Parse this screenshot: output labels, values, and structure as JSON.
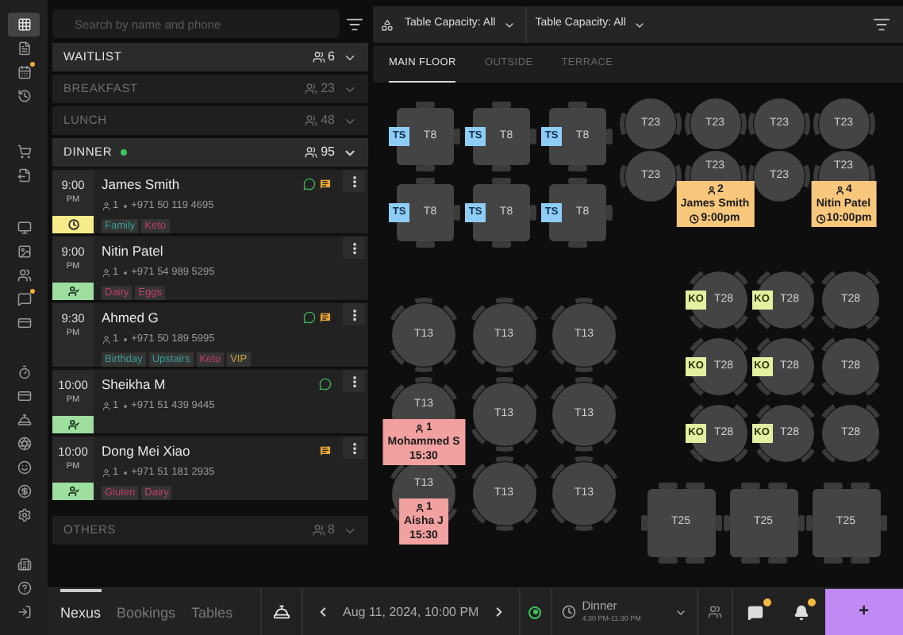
{
  "rail": {
    "groups": [
      [
        {
          "selected": true,
          "badge": false
        },
        {
          "selected": false,
          "badge": false
        },
        {
          "selected": false,
          "badge": true
        },
        {
          "selected": false,
          "badge": false
        }
      ],
      [
        {
          "selected": false,
          "badge": false
        },
        {
          "selected": false,
          "badge": false
        }
      ],
      [
        {
          "selected": false,
          "badge": false
        },
        {
          "selected": false,
          "badge": false
        },
        {
          "selected": false,
          "badge": false
        },
        {
          "selected": false,
          "badge": true
        },
        {
          "selected": false,
          "badge": false
        }
      ],
      [
        {
          "selected": false,
          "badge": false
        },
        {
          "selected": false,
          "badge": false
        },
        {
          "selected": false,
          "badge": false
        },
        {
          "selected": false,
          "badge": false
        },
        {
          "selected": false,
          "badge": false
        },
        {
          "selected": false,
          "badge": false
        },
        {
          "selected": false,
          "badge": false
        }
      ],
      [
        {
          "selected": false,
          "badge": false
        },
        {
          "selected": false,
          "badge": false
        },
        {
          "selected": false,
          "badge": false
        }
      ]
    ]
  },
  "search": {
    "placeholder": "Search by name and phone"
  },
  "sections": [
    {
      "title": "WAITLIST",
      "count": "6",
      "active": true,
      "live": false,
      "expanded": false
    },
    {
      "title": "BREAKFAST",
      "count": "23",
      "active": false,
      "live": false,
      "expanded": false
    },
    {
      "title": "LUNCH",
      "count": "48",
      "active": false,
      "live": false,
      "expanded": false
    },
    {
      "title": "DINNER",
      "count": "95",
      "active": true,
      "live": true,
      "expanded": true,
      "reservations": [
        {
          "time": "9:00",
          "period": "PM",
          "name": "James Smith",
          "party": "1",
          "phone": "+971 50 119 4695",
          "waiting": true,
          "seated": false,
          "whatsapp": true,
          "note": true,
          "tags": [
            {
              "label": "Family",
              "color": "#3a9e95"
            },
            {
              "label": "Keto",
              "color": "#c0406a"
            }
          ]
        },
        {
          "time": "9:00",
          "period": "PM",
          "name": "Nitin Patel",
          "party": "1",
          "phone": "+971 54 989 5295",
          "waiting": false,
          "seated": true,
          "whatsapp": false,
          "note": false,
          "tags": [
            {
              "label": "Dairy",
              "color": "#c0406a"
            },
            {
              "label": "Eggs",
              "color": "#c0406a"
            }
          ]
        },
        {
          "time": "9:30",
          "period": "PM",
          "name": "Ahmed G",
          "party": "1",
          "phone": "+971 50 189 5995",
          "waiting": false,
          "seated": false,
          "whatsapp": true,
          "note": true,
          "tags": [
            {
              "label": "Birthday",
              "color": "#3a9e95"
            },
            {
              "label": "Upstairs",
              "color": "#3a9e95"
            },
            {
              "label": "Keto",
              "color": "#c0406a"
            },
            {
              "label": "VIP",
              "color": "#c8a040"
            }
          ]
        },
        {
          "time": "10:00",
          "period": "PM",
          "name": "Sheikha M",
          "party": "1",
          "phone": "+971 51 439 9445",
          "waiting": false,
          "seated": true,
          "whatsapp": true,
          "note": false
        },
        {
          "time": "10:00",
          "period": "PM",
          "name": "Dong Mei Xiao",
          "party": "1",
          "phone": "+971 51 181 2935",
          "waiting": false,
          "seated": true,
          "whatsapp": false,
          "note": true,
          "tags": [
            {
              "label": "Gluten",
              "color": "#c0406a"
            },
            {
              "label": "Dairy",
              "color": "#c0406a"
            }
          ]
        }
      ]
    },
    {
      "title": "OTHERS",
      "count": "8",
      "active": false,
      "live": false,
      "expanded": false
    }
  ],
  "filters": [
    {
      "label": "Table Capacity: All"
    },
    {
      "label": "Table Capacity: All"
    }
  ],
  "floor_tabs": [
    {
      "label": "MAIN FLOOR",
      "selected": true
    },
    {
      "label": "OUTSIDE",
      "selected": false
    },
    {
      "label": "TERRACE",
      "selected": false
    }
  ],
  "floor": {
    "groups": [
      {
        "kind": "square",
        "tables": [
          {
            "label": "T8",
            "tag": {
              "text": "TS",
              "kind": "ts"
            }
          },
          {
            "label": "T8",
            "tag": {
              "text": "TS",
              "kind": "ts"
            }
          },
          {
            "label": "T8",
            "tag": {
              "text": "TS",
              "kind": "ts"
            }
          },
          {
            "label": "T8",
            "tag": {
              "text": "TS",
              "kind": "ts"
            }
          },
          {
            "label": "T8",
            "tag": {
              "text": "TS",
              "kind": "ts"
            }
          },
          {
            "label": "T8",
            "tag": {
              "text": "TS",
              "kind": "ts"
            }
          }
        ]
      },
      {
        "kind": "round",
        "tables": [
          {
            "label": "T23"
          },
          {
            "label": "T23"
          },
          {
            "label": "T23"
          },
          {
            "label": "T23"
          },
          {
            "label": "T23"
          },
          {
            "label": "T23",
            "booking": {
              "party": "2",
              "name": "James Smith",
              "time": "9:00pm",
              "overdue": false
            }
          },
          {
            "label": "T23"
          },
          {
            "label": "T23",
            "booking": {
              "party": "4",
              "name": "Nitin Patel",
              "time": "10:00pm",
              "overdue": false
            }
          }
        ]
      },
      {
        "kind": "round",
        "tables": [
          {
            "label": "T13"
          },
          {
            "label": "T13"
          },
          {
            "label": "T13"
          },
          {
            "label": "T13",
            "booking": {
              "party": "1",
              "name": "Mohammed S",
              "time": "15:30",
              "overdue": true
            }
          },
          {
            "label": "T13"
          },
          {
            "label": "T13"
          },
          {
            "label": "T13",
            "booking": {
              "party": "1",
              "name": "Aisha J",
              "time": "15:30",
              "overdue": true
            }
          },
          {
            "label": "T13"
          },
          {
            "label": "T13"
          }
        ]
      },
      {
        "kind": "round",
        "tables": [
          {
            "label": "T28",
            "tag": {
              "text": "KO",
              "kind": "ko"
            }
          },
          {
            "label": "T28",
            "tag": {
              "text": "KO",
              "kind": "ko"
            }
          },
          {
            "label": "T28"
          },
          {
            "label": "T28",
            "tag": {
              "text": "KO",
              "kind": "ko"
            }
          },
          {
            "label": "T28",
            "tag": {
              "text": "KO",
              "kind": "ko"
            }
          },
          {
            "label": "T28"
          },
          {
            "label": "T28",
            "tag": {
              "text": "KO",
              "kind": "ko"
            }
          },
          {
            "label": "T28",
            "tag": {
              "text": "KO",
              "kind": "ko"
            }
          },
          {
            "label": "T28"
          }
        ]
      },
      {
        "kind": "square",
        "tables": [
          {
            "label": "T25"
          },
          {
            "label": "T25"
          },
          {
            "label": "T25"
          }
        ]
      }
    ]
  },
  "bottom_tabs": [
    {
      "label": "Nexus",
      "selected": true
    },
    {
      "label": "Bookings",
      "selected": false
    },
    {
      "label": "Tables",
      "selected": false
    }
  ],
  "date": "Aug 11, 2024, 10:00 PM",
  "live": true,
  "service": {
    "name": "Dinner",
    "hours": "4:30 PM-11:30 PM"
  },
  "chat_badge": true,
  "alerts_badge": true,
  "add_button": "+"
}
